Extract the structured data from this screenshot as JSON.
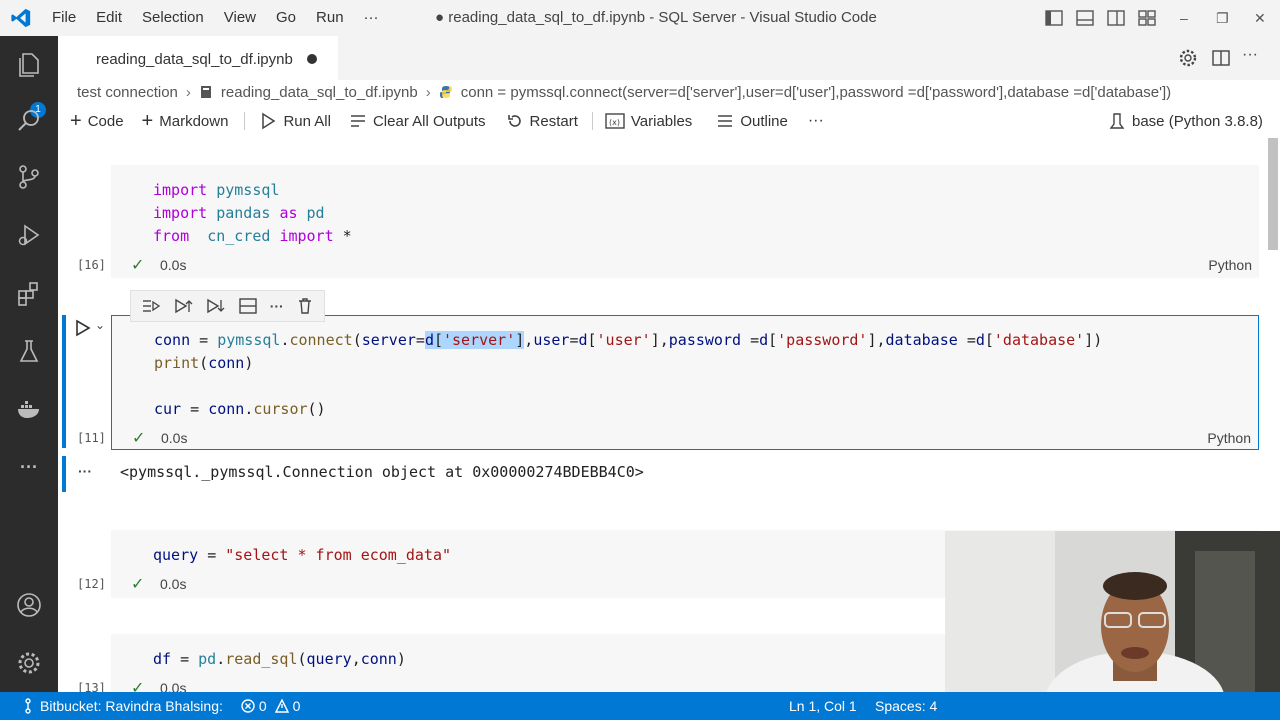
{
  "titlebar": {
    "menu": [
      "File",
      "Edit",
      "Selection",
      "View",
      "Go",
      "Run",
      "···"
    ],
    "window_title": "● reading_data_sql_to_df.ipynb - SQL Server - Visual Studio Code",
    "minimize": "–",
    "maximize": "❐",
    "close": "✕"
  },
  "activitybar": {
    "explorer_badge": "1",
    "more": "···"
  },
  "tab": {
    "label": "reading_data_sql_to_df.ipynb"
  },
  "breadcrumb": {
    "items": [
      "test connection",
      "reading_data_sql_to_df.ipynb",
      "conn = pymssql.connect(server=d['server'],user=d['user'],password =d['password'],database =d['database'])"
    ]
  },
  "toolbar": {
    "code": "Code",
    "markdown": "Markdown",
    "run_all": "Run All",
    "clear_outputs": "Clear All Outputs",
    "restart": "Restart",
    "variables": "Variables",
    "outline": "Outline",
    "more": "···",
    "kernel": "base (Python 3.8.8)"
  },
  "cells": {
    "c1": {
      "count": "[16]",
      "time": "0.0s",
      "lang": "Python"
    },
    "c2": {
      "count": "[11]",
      "time": "0.0s",
      "lang": "Python",
      "output": "<pymssql._pymssql.Connection object at 0x00000274BDEBB4C0>"
    },
    "c3": {
      "count": "[12]",
      "time": "0.0s"
    },
    "c4": {
      "count": "[13]",
      "time": "0.0s"
    }
  },
  "statusbar": {
    "branch": "Bitbucket: Ravindra Bhalsing:",
    "errors": "0",
    "warnings": "0",
    "position": "Ln 1, Col 1",
    "spaces": "Spaces: 4"
  },
  "colors": {
    "accent": "#0078d4",
    "activitybar": "#2c2c2c",
    "keyword": "#af00db",
    "string": "#a31515"
  }
}
